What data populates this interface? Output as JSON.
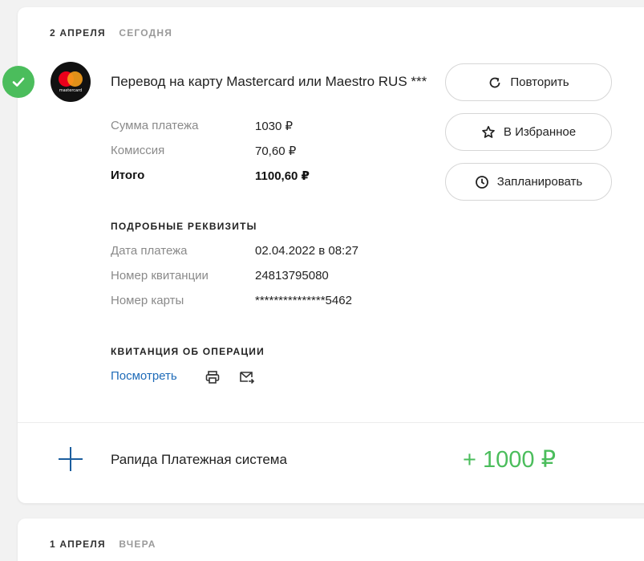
{
  "day1": {
    "date": "2 АПРЕЛЯ",
    "relative": "СЕГОДНЯ"
  },
  "operation1": {
    "title": "Перевод на карту Mastercard или Maestro RUS ***",
    "logo_text": "mastercard",
    "amounts": [
      {
        "label": "Сумма платежа",
        "value": "1030 ₽"
      },
      {
        "label": "Комиссия",
        "value": "70,60 ₽"
      },
      {
        "label": "Итого",
        "value": "1100,60 ₽"
      }
    ],
    "details_title": "ПОДРОБНЫЕ РЕКВИЗИТЫ",
    "details": [
      {
        "label": "Дата платежа",
        "value": "02.04.2022 в 08:27"
      },
      {
        "label": "Номер квитанции",
        "value": "24813795080"
      },
      {
        "label": "Номер карты",
        "value": "***************5462"
      }
    ],
    "receipt_title": "КВИТАНЦИЯ ОБ ОПЕРАЦИИ",
    "receipt_link": "Посмотреть",
    "actions": {
      "repeat": "Повторить",
      "favorite": "В Избранное",
      "schedule": "Запланировать"
    },
    "status_icon": "check-icon"
  },
  "operation2": {
    "title": "Рапида Платежная система",
    "amount": "+ 1000 ₽",
    "icon": "plus-icon"
  },
  "day2": {
    "date": "1 АПРЕЛЯ",
    "relative": "ВЧЕРА"
  },
  "colors": {
    "success": "#4bbd5c",
    "link": "#1e6bb8",
    "background": "#f2f2f2",
    "accent_blue": "#1b5e9e"
  }
}
